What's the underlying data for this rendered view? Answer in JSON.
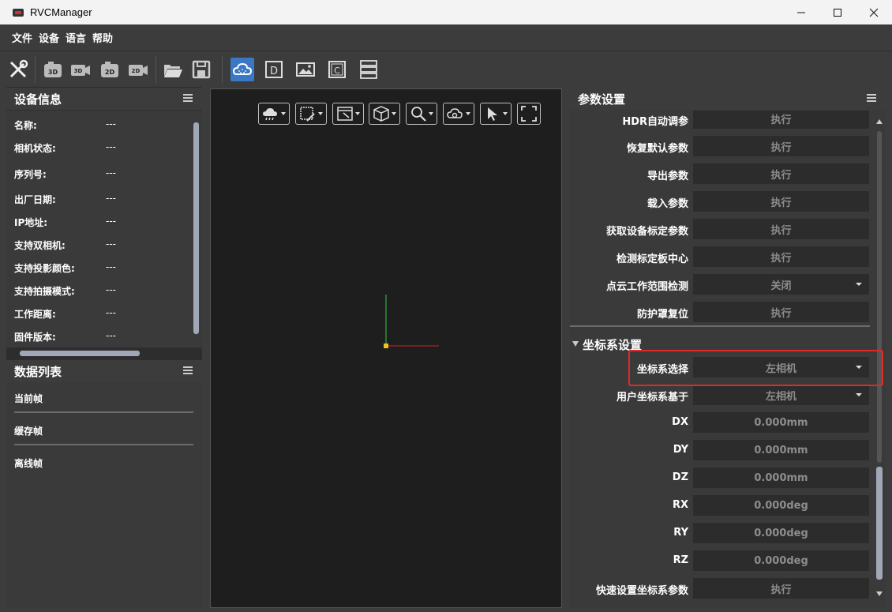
{
  "window": {
    "title": "RVCManager"
  },
  "menu": [
    "文件",
    "设备",
    "语言",
    "帮助"
  ],
  "device_info": {
    "title": "设备信息",
    "rows": [
      {
        "label": "名称:",
        "value": "---"
      },
      {
        "label": "相机状态:",
        "value": "---"
      },
      {
        "label": "序列号:",
        "value": "---"
      },
      {
        "label": "出厂日期:",
        "value": "---"
      },
      {
        "label": "IP地址:",
        "value": "---"
      },
      {
        "label": "支持双相机:",
        "value": "---"
      },
      {
        "label": "支持投影颜色:",
        "value": "---"
      },
      {
        "label": "支持拍摄模式:",
        "value": "---"
      },
      {
        "label": "工作距离:",
        "value": "---"
      },
      {
        "label": "固件版本:",
        "value": "---"
      }
    ]
  },
  "data_list": {
    "title": "数据列表",
    "items": [
      "当前帧",
      "缓存帧",
      "离线帧"
    ]
  },
  "params": {
    "title": "参数设置",
    "rows": [
      {
        "label": "HDR自动调参",
        "value": "执行"
      },
      {
        "label": "恢复默认参数",
        "value": "执行"
      },
      {
        "label": "导出参数",
        "value": "执行"
      },
      {
        "label": "载入参数",
        "value": "执行"
      },
      {
        "label": "获取设备标定参数",
        "value": "执行"
      },
      {
        "label": "检测标定板中心",
        "value": "执行"
      },
      {
        "label": "点云工作范围检测",
        "value": "关闭"
      },
      {
        "label": "防护罩复位",
        "value": "执行"
      }
    ],
    "coord_section": {
      "title": "坐标系设置",
      "rows": [
        {
          "label": "坐标系选择",
          "value": "左相机"
        },
        {
          "label": "用户坐标系基于",
          "value": "左相机"
        },
        {
          "label": "DX",
          "value": "0.000mm"
        },
        {
          "label": "DY",
          "value": "0.000mm"
        },
        {
          "label": "DZ",
          "value": "0.000mm"
        },
        {
          "label": "RX",
          "value": "0.000deg"
        },
        {
          "label": "RY",
          "value": "0.000deg"
        },
        {
          "label": "RZ",
          "value": "0.000deg"
        },
        {
          "label": "快速设置坐标系参数",
          "value": "执行"
        }
      ]
    }
  },
  "toolbar_labels": {
    "cam3d": "3D",
    "cam3d_small": "3D",
    "cam2d": "2D",
    "cam2d_small": "2D",
    "view_d": "D",
    "view_c": "C"
  },
  "colors": {
    "accent": "#3a78c3",
    "highlight": "#e02a2a",
    "axis_y": "#2ecc40",
    "axis_x": "#d22020",
    "origin": "#f0c020"
  }
}
